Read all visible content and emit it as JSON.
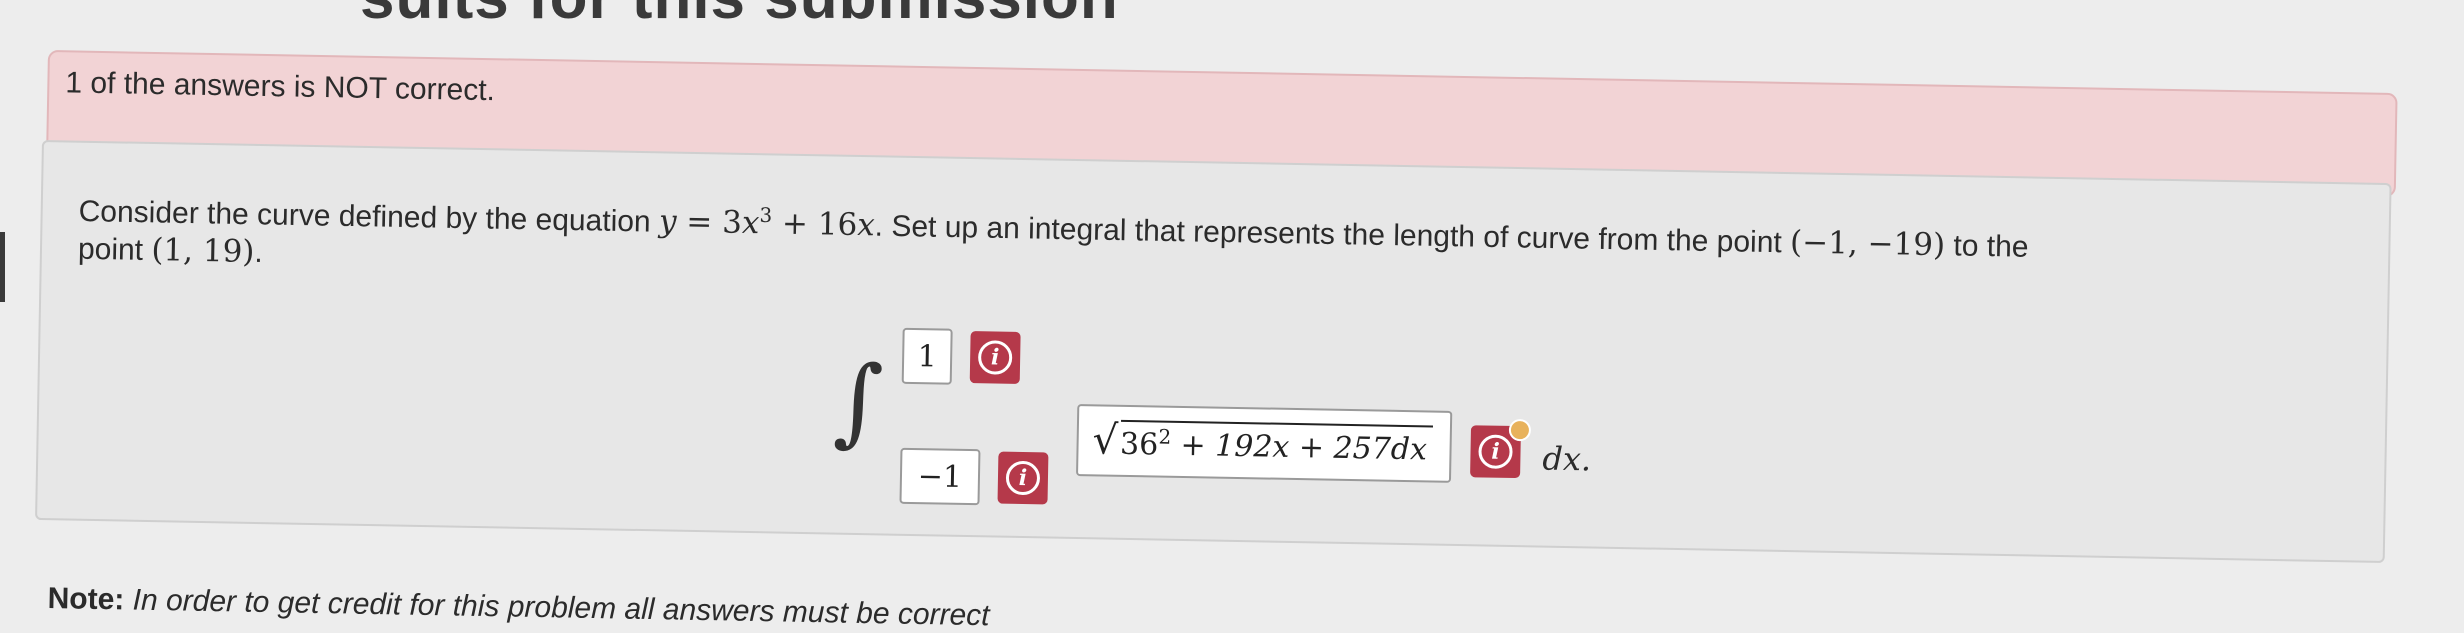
{
  "header": {
    "partial_title": "sults for this submission"
  },
  "alert": {
    "text": "1 of the answers is NOT correct."
  },
  "problem": {
    "line1_start": "Consider the curve defined by the equation ",
    "equation_y": "y",
    "equation_eq": " = 3",
    "equation_x3": "x",
    "equation_exp3": "3",
    "equation_rest": " + 16",
    "equation_x": "x",
    "line1_mid": ". Set up an integral that represents the length of curve from the point ",
    "point_start": "(−1, −19)",
    "line1_end": " to the",
    "line2_start": "point ",
    "point_end": "(1, 19)",
    "line2_end": "."
  },
  "integral": {
    "symbol": "∫",
    "upper_limit": "1",
    "lower_limit": "−1",
    "integrand_base": "36",
    "integrand_exp": "2",
    "integrand_rest": " + 192x + 257dx",
    "differential": "dx."
  },
  "info_icon_glyph": "i",
  "note": {
    "label": "Note:",
    "text": " In order to get credit for this problem all answers must be correct"
  },
  "colors": {
    "alert_bg": "#f2d3d5",
    "info_button": "#b5394a",
    "panel_bg": "#e7e7e7"
  }
}
